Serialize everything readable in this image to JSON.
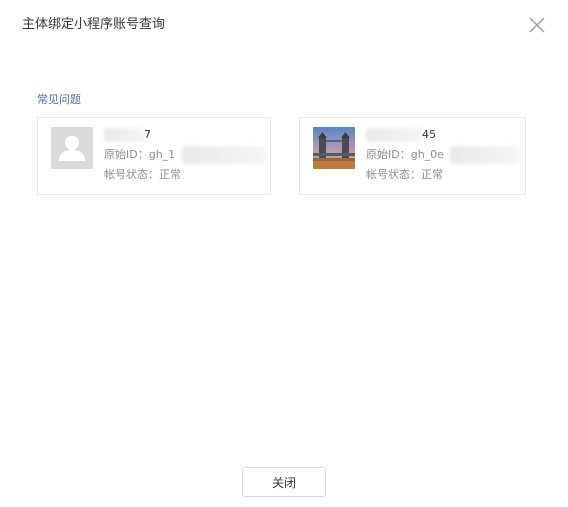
{
  "dialog": {
    "title": "主体绑定小程序账号查询",
    "faq_link": "常见问题",
    "close_button": "关闭"
  },
  "accounts": [
    {
      "name_suffix": "7",
      "id_label": "原始ID：",
      "id_prefix": "gh_1",
      "status_label": "帐号状态：",
      "status_value": "正常",
      "avatar": "default-user-avatar"
    },
    {
      "name_suffix": "45",
      "id_label": "原始ID：",
      "id_prefix": "gh_0e",
      "status_label": "帐号状态：",
      "status_value": "正常",
      "avatar": "bridge-photo-avatar"
    }
  ],
  "colors": {
    "link": "#576b95",
    "border": "#e7e7eb",
    "text": "#353535",
    "muted": "#8d8d8d"
  }
}
